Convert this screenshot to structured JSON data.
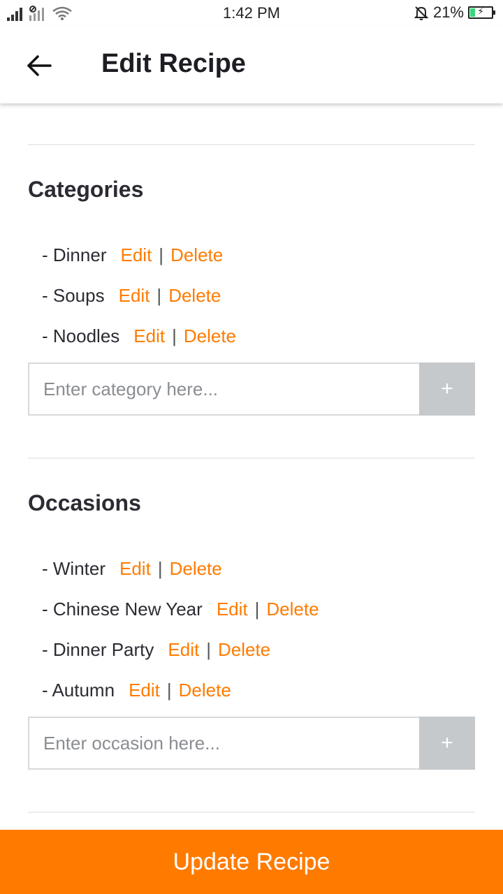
{
  "status_bar": {
    "time": "1:42 PM",
    "battery_percent": "21%",
    "battery_level": 0.21,
    "icons": [
      "signal-icon",
      "signal-icon",
      "wifi-icon",
      "mute-icon",
      "battery-icon"
    ]
  },
  "app_bar": {
    "title": "Edit Recipe",
    "back_icon": "arrow-left-icon"
  },
  "categories": {
    "title": "Categories",
    "items": [
      {
        "label": "- Dinner",
        "edit": "Edit",
        "sep": "|",
        "delete": "Delete"
      },
      {
        "label": "- Soups",
        "edit": "Edit",
        "sep": "|",
        "delete": "Delete"
      },
      {
        "label": "- Noodles",
        "edit": "Edit",
        "sep": "|",
        "delete": "Delete"
      }
    ],
    "input_value": "",
    "input_placeholder": "Enter category here...",
    "add_label": "+"
  },
  "occasions": {
    "title": "Occasions",
    "items": [
      {
        "label": "- Winter",
        "edit": "Edit",
        "sep": "|",
        "delete": "Delete"
      },
      {
        "label": "- Chinese New Year",
        "edit": "Edit",
        "sep": "|",
        "delete": "Delete"
      },
      {
        "label": "- Dinner Party",
        "edit": "Edit",
        "sep": "|",
        "delete": "Delete"
      },
      {
        "label": "- Autumn",
        "edit": "Edit",
        "sep": "|",
        "delete": "Delete"
      }
    ],
    "input_value": "",
    "input_placeholder": "Enter occasion here...",
    "add_label": "+"
  },
  "footer": {
    "update_label": "Update Recipe"
  },
  "colors": {
    "accent": "#ff7b00",
    "add_button": "#c5c9cc",
    "battery_charge": "#37d67a"
  }
}
